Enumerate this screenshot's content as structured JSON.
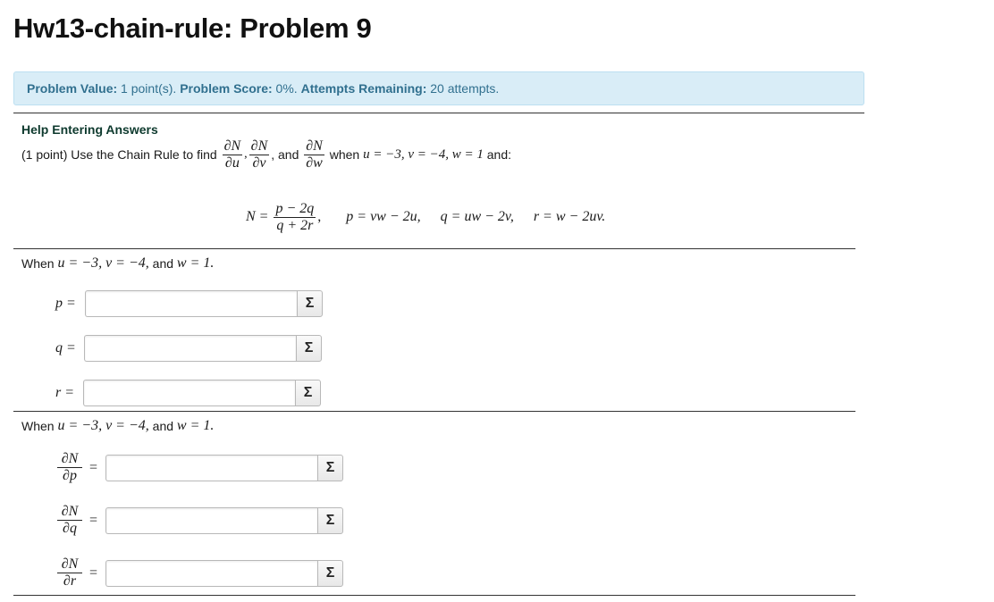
{
  "title": "Hw13-chain-rule: Problem 9",
  "info": {
    "value_label": "Problem Value:",
    "value": " 1 point(s). ",
    "score_label": "Problem Score:",
    "score": " 0%. ",
    "attempts_label": "Attempts Remaining:",
    "attempts": " 20 attempts."
  },
  "help_link": "Help Entering Answers",
  "statement": {
    "prefix": "(1 point) Use the Chain Rule to find ",
    "frac1": {
      "num": "∂N",
      "den": "∂u"
    },
    "comma1": ",",
    "frac2": {
      "num": "∂N",
      "den": "∂v"
    },
    "and": ", and ",
    "frac3": {
      "num": "∂N",
      "den": "∂w"
    },
    "when": " when ",
    "conditions": "u = −3, v = −4, w = 1",
    "suffix": " and:"
  },
  "equation": {
    "lhs": "N = ",
    "num": "p − 2q",
    "den": "q + 2r",
    "after": ",",
    "p": "p = vw − 2u,",
    "q": "q = uw − 2v,",
    "r": "r = w − 2uv."
  },
  "section1": {
    "text1": "When ",
    "math": "u = −3, v = −4,",
    "text2": " and ",
    "math2": "w = 1.",
    "rows": [
      {
        "label": "p =",
        "value": ""
      },
      {
        "label": "q =",
        "value": ""
      },
      {
        "label": "r =",
        "value": ""
      }
    ]
  },
  "section2": {
    "text1": "When ",
    "math": "u = −3, v = −4,",
    "text2": " and ",
    "math2": "w = 1.",
    "rows": [
      {
        "num": "∂N",
        "den": "∂p",
        "eq": "=",
        "value": ""
      },
      {
        "num": "∂N",
        "den": "∂q",
        "eq": "=",
        "value": ""
      },
      {
        "num": "∂N",
        "den": "∂r",
        "eq": "=",
        "value": ""
      }
    ]
  },
  "sigma_icon": "Σ"
}
